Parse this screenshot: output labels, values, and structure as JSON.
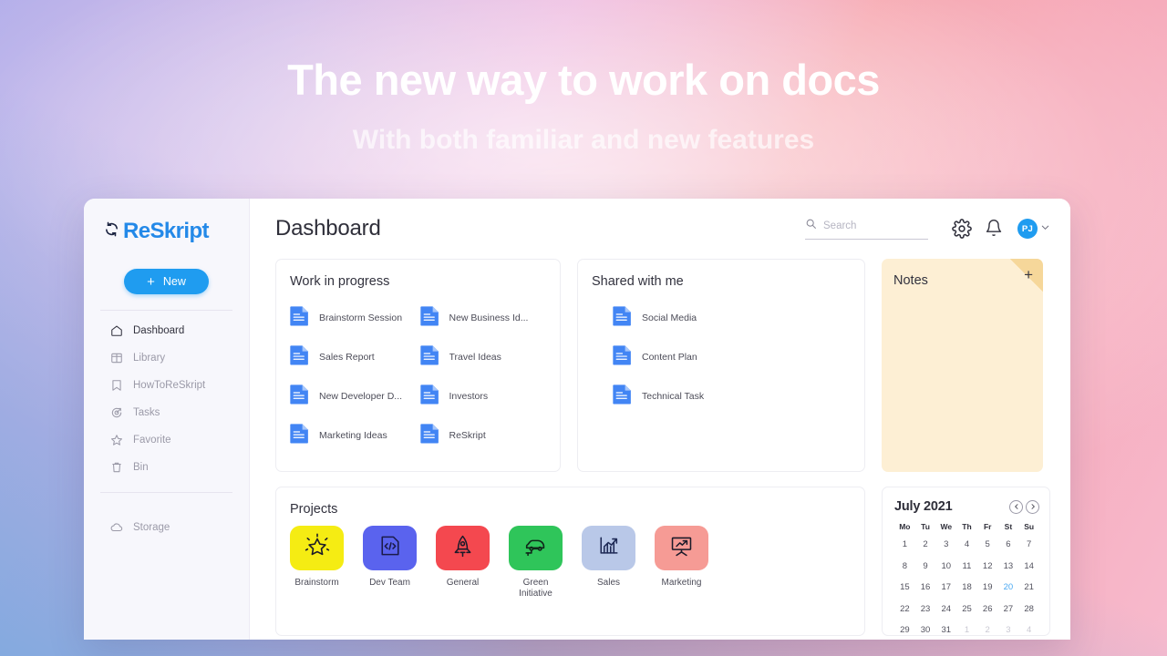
{
  "hero": {
    "title": "The new way to work on docs",
    "subtitle": "With both familiar and new features"
  },
  "colors": {
    "brand_blue": "#2489e8",
    "button_blue": "#1f9cf0",
    "note_yellow": "#fdefd4",
    "note_fold": "#f6d79a",
    "today_blue": "#49a8f2"
  },
  "sidebar": {
    "logo_text": "ReSkript",
    "logo_icon": "refresh-sync-icon",
    "new_button": {
      "label": "New",
      "icon": "plus-icon"
    },
    "items": [
      {
        "label": "Dashboard",
        "icon": "home-icon",
        "active": true
      },
      {
        "label": "Library",
        "icon": "library-icon",
        "active": false
      },
      {
        "label": "HowToReSkript",
        "icon": "bookmark-icon",
        "active": false
      },
      {
        "label": "Tasks",
        "icon": "target-arrow-icon",
        "active": false
      },
      {
        "label": "Favorite",
        "icon": "star-icon",
        "active": false
      },
      {
        "label": "Bin",
        "icon": "trash-icon",
        "active": false
      }
    ],
    "storage": {
      "label": "Storage",
      "icon": "cloud-icon"
    }
  },
  "topbar": {
    "page_title": "Dashboard",
    "search": {
      "placeholder": "Search",
      "value": "",
      "icon": "search-icon"
    },
    "settings_icon": "gear-icon",
    "notifications_icon": "bell-icon",
    "avatar_initials": "PJ",
    "avatar_chevron": "chevron-down-icon"
  },
  "work_in_progress": {
    "title": "Work in progress",
    "documents": [
      "Brainstorm Session",
      "New Business Id...",
      "Sales Report",
      "Travel Ideas",
      "New Developer D...",
      "Investors",
      "Marketing Ideas",
      "ReSkript"
    ]
  },
  "shared_with_me": {
    "title": "Shared with me",
    "documents": [
      "Social Media",
      "Content Plan",
      "Technical Task"
    ]
  },
  "notes": {
    "title": "Notes",
    "add_label": "+"
  },
  "projects": {
    "title": "Projects",
    "items": [
      {
        "label": "Brainstorm",
        "icon": "star-sparkle-icon",
        "tile_color": "#f5ec13",
        "icon_color": "#1b1b2a"
      },
      {
        "label": "Dev Team",
        "icon": "code-file-icon",
        "tile_color": "#5a63ee",
        "icon_color": "#1b1b4a"
      },
      {
        "label": "General",
        "icon": "rocket-icon",
        "tile_color": "#f4484f",
        "icon_color": "#1b1b2a"
      },
      {
        "label": "Green Initiative",
        "icon": "electric-car-icon",
        "tile_color": "#2fc55a",
        "icon_color": "#10261a"
      },
      {
        "label": "Sales",
        "icon": "bar-chart-arrow-icon",
        "tile_color": "#b9c8e8",
        "icon_color": "#1f2a56"
      },
      {
        "label": "Marketing",
        "icon": "presentation-chart-icon",
        "tile_color": "#f69b95",
        "icon_color": "#1b1b2a"
      }
    ]
  },
  "calendar": {
    "title": "July 2021",
    "prev_icon": "chevron-left-icon",
    "next_icon": "chevron-right-icon",
    "weekdays": [
      "Mo",
      "Tu",
      "We",
      "Th",
      "Fr",
      "St",
      "Su"
    ],
    "today": 20,
    "days": [
      {
        "n": 1,
        "muted": false
      },
      {
        "n": 2,
        "muted": false
      },
      {
        "n": 3,
        "muted": false
      },
      {
        "n": 4,
        "muted": false
      },
      {
        "n": 5,
        "muted": false
      },
      {
        "n": 6,
        "muted": false
      },
      {
        "n": 7,
        "muted": false
      },
      {
        "n": 8,
        "muted": false
      },
      {
        "n": 9,
        "muted": false
      },
      {
        "n": 10,
        "muted": false
      },
      {
        "n": 11,
        "muted": false
      },
      {
        "n": 12,
        "muted": false
      },
      {
        "n": 13,
        "muted": false
      },
      {
        "n": 14,
        "muted": false
      },
      {
        "n": 15,
        "muted": false
      },
      {
        "n": 16,
        "muted": false
      },
      {
        "n": 17,
        "muted": false
      },
      {
        "n": 18,
        "muted": false
      },
      {
        "n": 19,
        "muted": false
      },
      {
        "n": 20,
        "muted": false
      },
      {
        "n": 21,
        "muted": false
      },
      {
        "n": 22,
        "muted": false
      },
      {
        "n": 23,
        "muted": false
      },
      {
        "n": 24,
        "muted": false
      },
      {
        "n": 25,
        "muted": false
      },
      {
        "n": 26,
        "muted": false
      },
      {
        "n": 27,
        "muted": false
      },
      {
        "n": 28,
        "muted": false
      },
      {
        "n": 29,
        "muted": false
      },
      {
        "n": 30,
        "muted": false
      },
      {
        "n": 31,
        "muted": false
      },
      {
        "n": 1,
        "muted": true
      },
      {
        "n": 2,
        "muted": true
      },
      {
        "n": 3,
        "muted": true
      },
      {
        "n": 4,
        "muted": true
      }
    ]
  }
}
